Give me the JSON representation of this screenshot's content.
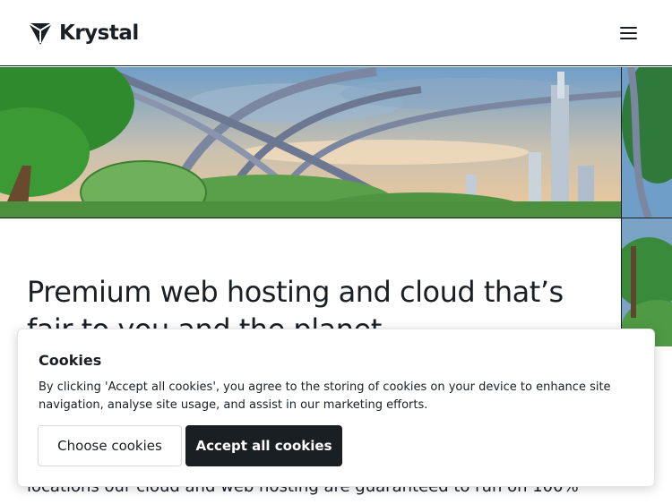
{
  "header": {
    "logo_text": "Krystal",
    "logo_icon": "krystal-gem-icon",
    "menu_icon": "hamburger-menu-icon"
  },
  "hero": {
    "illustration": "futuristic-city-landscape",
    "colors": {
      "sky": "#e9c7a0",
      "foliage": "#3e9a3a",
      "tube": "#7d8ea8"
    }
  },
  "main": {
    "headline": "Premium web hosting and cloud that’s fair to you and the planet",
    "body_partial": "locations our cloud and web hosting are guaranteed to run on 100%"
  },
  "cookie_banner": {
    "title": "Cookies",
    "text": "By clicking 'Accept all cookies', you agree to the storing of cookies on your device to enhance site navigation, analyse site usage, and assist in our marketing efforts.",
    "choose_label": "Choose cookies",
    "accept_label": "Accept all cookies"
  },
  "colors": {
    "ink": "#1a1f24",
    "background": "#ffffff"
  }
}
